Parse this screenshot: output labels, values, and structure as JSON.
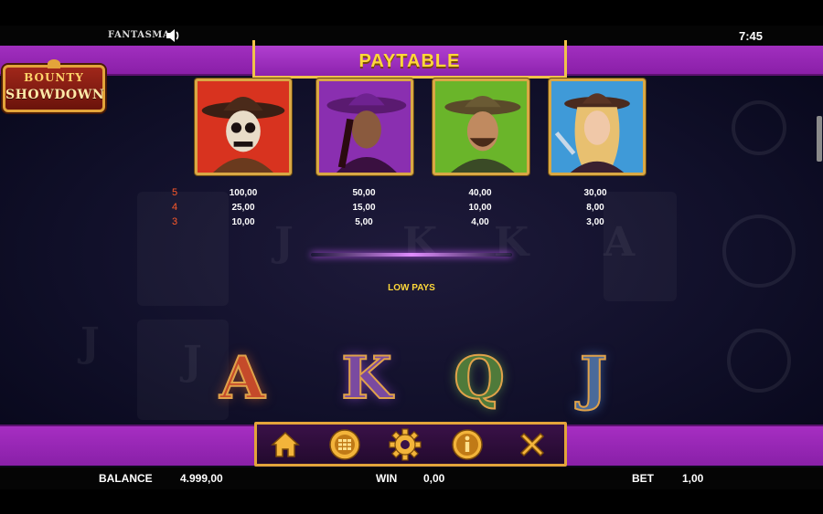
{
  "top_bar": {
    "brand": "FANTASMA",
    "clock": "7:45"
  },
  "header": {
    "title": "PAYTABLE"
  },
  "logo": {
    "line1": "BOUNTY",
    "line2": "SHOWDOWN"
  },
  "high_pays": {
    "counts": [
      "5",
      "4",
      "3"
    ],
    "symbols": [
      {
        "name": "skeleton-cowboy",
        "background": "#d8331f",
        "payouts": [
          "100,00",
          "25,00",
          "10,00"
        ]
      },
      {
        "name": "outlaw-woman",
        "background": "#8a2fb0",
        "payouts": [
          "50,00",
          "15,00",
          "5,00"
        ]
      },
      {
        "name": "bearded-cowboy",
        "background": "#6ab52a",
        "payouts": [
          "40,00",
          "10,00",
          "4,00"
        ]
      },
      {
        "name": "blonde-cowgirl",
        "background": "#3f9ad8",
        "payouts": [
          "30,00",
          "8,00",
          "3,00"
        ]
      }
    ]
  },
  "low_pays": {
    "title": "LOW PAYS",
    "letters": [
      "A",
      "K",
      "Q",
      "J"
    ]
  },
  "menu": {
    "buttons": [
      "home-icon",
      "grid-menu-icon",
      "gear-icon",
      "info-icon",
      "close-icon"
    ]
  },
  "status": {
    "balance_label": "BALANCE",
    "balance_value": "4.999,00",
    "win_label": "WIN",
    "win_value": "0,00",
    "bet_label": "BET",
    "bet_value": "1,00"
  },
  "colors": {
    "accent_purple": "#9a27b8",
    "gold": "#e3a43a",
    "title_yellow": "#ffd83a",
    "count_red": "#ff5a2a"
  }
}
